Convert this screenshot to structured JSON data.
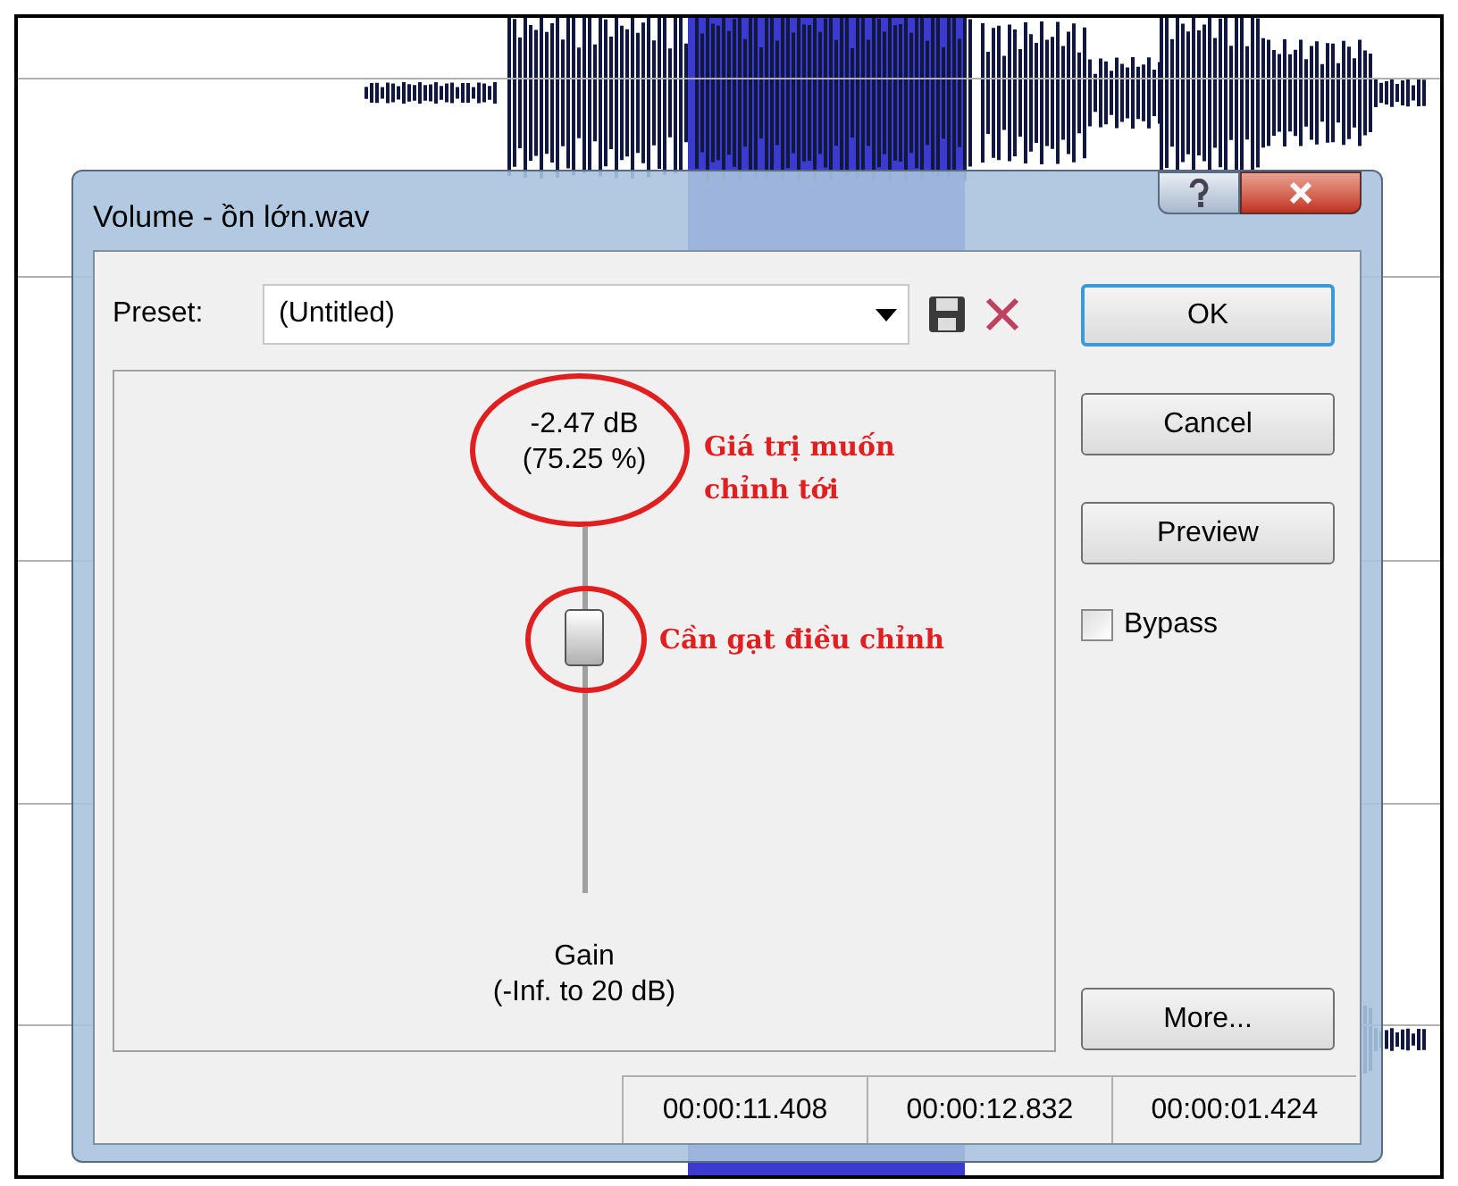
{
  "window": {
    "title": "Volume - ồn lớn.wav"
  },
  "preset": {
    "label": "Preset:",
    "value": "(Untitled)"
  },
  "gain": {
    "reading": "-2.47 dB",
    "percent": "(75.25 %)",
    "level": 0.7,
    "label": "Gain",
    "range": "(-Inf. to 20 dB)"
  },
  "annotations": [
    {
      "kind": "value",
      "text": "Giá trị muốn chỉnh tới"
    },
    {
      "kind": "thumb",
      "text": "Cần gạt điều chỉnh"
    }
  ],
  "buttons": [
    {
      "label": "OK",
      "default": true
    },
    {
      "label": "Cancel",
      "default": false
    },
    {
      "label": "Preview",
      "default": false
    }
  ],
  "bypass": {
    "label": "Bypass",
    "checked": false
  },
  "more_button": "More...",
  "status_bar": [
    "00:00:11.408",
    "00:00:12.832",
    "00:00:01.424"
  ]
}
